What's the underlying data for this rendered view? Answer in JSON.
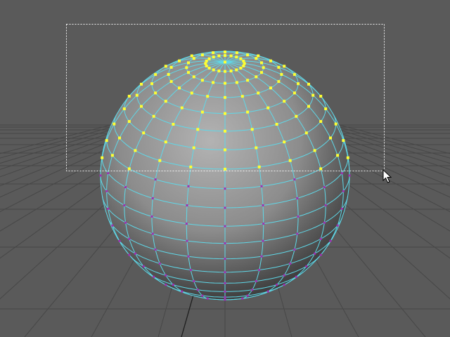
{
  "viewport": {
    "background": "#5a5a5a",
    "mode": "vertex-selection"
  },
  "grid": {
    "color": "#474747",
    "axis_color": "#1e1e1e",
    "visible": true
  },
  "sphere": {
    "subdivisions_axis": 20,
    "subdivisions_height": 20,
    "shading": {
      "highlight": "#b3b3b3",
      "mid": "#8c8c8c",
      "shadow": "#3a3a3a"
    },
    "wireframe_color": "#5fd8e8"
  },
  "vertices": {
    "selected_color": "#ffff33",
    "unselected_color": "#a02fb0"
  },
  "marquee": {
    "color": "#ffffff",
    "style": "dashed",
    "active": true
  },
  "cursor": {
    "icon": "arrow-pointer-icon"
  }
}
